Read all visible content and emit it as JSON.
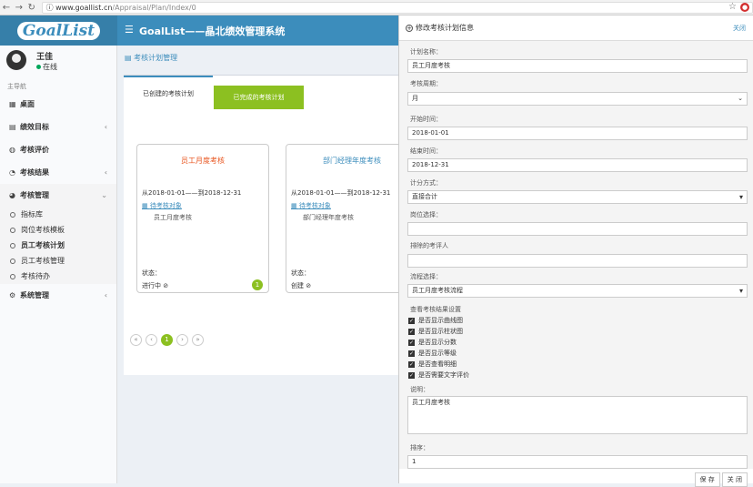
{
  "browser": {
    "url_host": "www.goallist.cn",
    "url_path": "/Appraisal/Plan/Index/0"
  },
  "header": {
    "logo": "GoalList",
    "title": "GoalList——晶北绩效管理系统"
  },
  "user": {
    "name": "王佳",
    "status": "在线"
  },
  "sidebar": {
    "nav_header": "主导航",
    "items": [
      {
        "label": "桌面",
        "icon": "grid-icon"
      },
      {
        "label": "绩效目标",
        "icon": "book-icon"
      },
      {
        "label": "考核评价",
        "icon": "comment-icon"
      },
      {
        "label": "考核结果",
        "icon": "pie-icon"
      },
      {
        "label": "考核管理",
        "icon": "dashboard-icon"
      }
    ],
    "subitems": [
      "指标库",
      "岗位考核模板",
      "员工考核计划",
      "员工考核管理",
      "考核待办"
    ],
    "last": "系统管理"
  },
  "content": {
    "page_title": "考核计划管理",
    "tabs": [
      "已创建的考核计划",
      "已完成的考核计划"
    ],
    "cards": [
      {
        "title": "员工月度考核",
        "date": "从2018-01-01——到2018-12-31",
        "link": "待考核对象",
        "name": "员工月度考核",
        "status_label": "状态：",
        "status": "进行中",
        "badge": "1",
        "color": "#e8541e"
      },
      {
        "title": "部门经理年度考核",
        "date": "从2018-01-01——到2018-12-31",
        "link": "待考核对象",
        "name": "部门经理年度考核",
        "status_label": "状态：",
        "status": "创建",
        "badge": "",
        "color": "#3c8dbc"
      }
    ],
    "pager": [
      "«",
      "‹",
      "1",
      "›",
      "»"
    ]
  },
  "modal": {
    "title": "修改考核计划信息",
    "close": "关闭",
    "plan_name_label": "计划名称：",
    "plan_name": "员工月度考核",
    "period_label": "考核周期：",
    "period": "月",
    "start_label": "开始时间：",
    "start": "2018-01-01",
    "end_label": "结束时间：",
    "end": "2018-12-31",
    "score_label": "计分方式：",
    "score": "直接合计",
    "post_label": "岗位选择：",
    "post": "",
    "exclude_label": "排除的考评人",
    "exclude": "",
    "flow_label": "流程选择：",
    "flow": "员工月度考核流程",
    "view_label": "查看考核结果设置",
    "checks": [
      "是否显示曲线图",
      "是否显示柱状图",
      "是否显示分数",
      "是否显示等级",
      "是否查看明细",
      "是否需要文字评价"
    ],
    "desc_label": "说明：",
    "desc": "员工月度考核",
    "order_label": "排序：",
    "order": "1",
    "save": "保 存",
    "cancel": "关 闭"
  }
}
